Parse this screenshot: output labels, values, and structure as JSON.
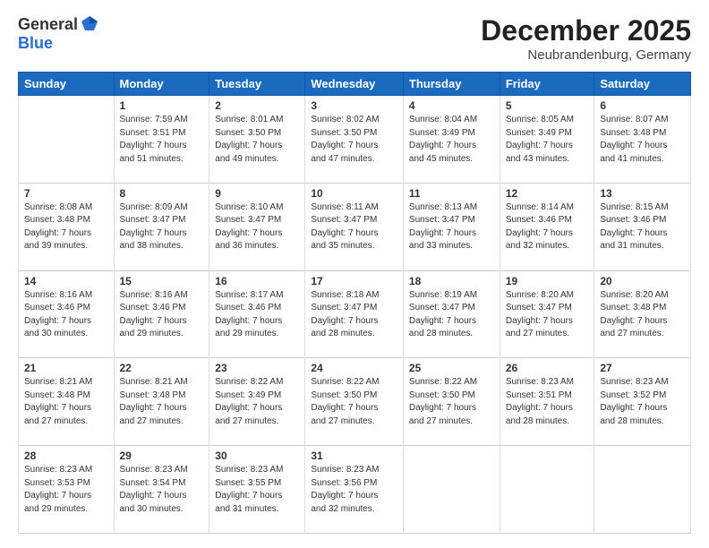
{
  "logo": {
    "general": "General",
    "blue": "Blue"
  },
  "title": "December 2025",
  "subtitle": "Neubrandenburg, Germany",
  "days_of_week": [
    "Sunday",
    "Monday",
    "Tuesday",
    "Wednesday",
    "Thursday",
    "Friday",
    "Saturday"
  ],
  "weeks": [
    [
      {
        "day": "",
        "info": ""
      },
      {
        "day": "1",
        "info": "Sunrise: 7:59 AM\nSunset: 3:51 PM\nDaylight: 7 hours\nand 51 minutes."
      },
      {
        "day": "2",
        "info": "Sunrise: 8:01 AM\nSunset: 3:50 PM\nDaylight: 7 hours\nand 49 minutes."
      },
      {
        "day": "3",
        "info": "Sunrise: 8:02 AM\nSunset: 3:50 PM\nDaylight: 7 hours\nand 47 minutes."
      },
      {
        "day": "4",
        "info": "Sunrise: 8:04 AM\nSunset: 3:49 PM\nDaylight: 7 hours\nand 45 minutes."
      },
      {
        "day": "5",
        "info": "Sunrise: 8:05 AM\nSunset: 3:49 PM\nDaylight: 7 hours\nand 43 minutes."
      },
      {
        "day": "6",
        "info": "Sunrise: 8:07 AM\nSunset: 3:48 PM\nDaylight: 7 hours\nand 41 minutes."
      }
    ],
    [
      {
        "day": "7",
        "info": "Sunrise: 8:08 AM\nSunset: 3:48 PM\nDaylight: 7 hours\nand 39 minutes."
      },
      {
        "day": "8",
        "info": "Sunrise: 8:09 AM\nSunset: 3:47 PM\nDaylight: 7 hours\nand 38 minutes."
      },
      {
        "day": "9",
        "info": "Sunrise: 8:10 AM\nSunset: 3:47 PM\nDaylight: 7 hours\nand 36 minutes."
      },
      {
        "day": "10",
        "info": "Sunrise: 8:11 AM\nSunset: 3:47 PM\nDaylight: 7 hours\nand 35 minutes."
      },
      {
        "day": "11",
        "info": "Sunrise: 8:13 AM\nSunset: 3:47 PM\nDaylight: 7 hours\nand 33 minutes."
      },
      {
        "day": "12",
        "info": "Sunrise: 8:14 AM\nSunset: 3:46 PM\nDaylight: 7 hours\nand 32 minutes."
      },
      {
        "day": "13",
        "info": "Sunrise: 8:15 AM\nSunset: 3:46 PM\nDaylight: 7 hours\nand 31 minutes."
      }
    ],
    [
      {
        "day": "14",
        "info": "Sunrise: 8:16 AM\nSunset: 3:46 PM\nDaylight: 7 hours\nand 30 minutes."
      },
      {
        "day": "15",
        "info": "Sunrise: 8:16 AM\nSunset: 3:46 PM\nDaylight: 7 hours\nand 29 minutes."
      },
      {
        "day": "16",
        "info": "Sunrise: 8:17 AM\nSunset: 3:46 PM\nDaylight: 7 hours\nand 29 minutes."
      },
      {
        "day": "17",
        "info": "Sunrise: 8:18 AM\nSunset: 3:47 PM\nDaylight: 7 hours\nand 28 minutes."
      },
      {
        "day": "18",
        "info": "Sunrise: 8:19 AM\nSunset: 3:47 PM\nDaylight: 7 hours\nand 28 minutes."
      },
      {
        "day": "19",
        "info": "Sunrise: 8:20 AM\nSunset: 3:47 PM\nDaylight: 7 hours\nand 27 minutes."
      },
      {
        "day": "20",
        "info": "Sunrise: 8:20 AM\nSunset: 3:48 PM\nDaylight: 7 hours\nand 27 minutes."
      }
    ],
    [
      {
        "day": "21",
        "info": "Sunrise: 8:21 AM\nSunset: 3:48 PM\nDaylight: 7 hours\nand 27 minutes."
      },
      {
        "day": "22",
        "info": "Sunrise: 8:21 AM\nSunset: 3:48 PM\nDaylight: 7 hours\nand 27 minutes."
      },
      {
        "day": "23",
        "info": "Sunrise: 8:22 AM\nSunset: 3:49 PM\nDaylight: 7 hours\nand 27 minutes."
      },
      {
        "day": "24",
        "info": "Sunrise: 8:22 AM\nSunset: 3:50 PM\nDaylight: 7 hours\nand 27 minutes."
      },
      {
        "day": "25",
        "info": "Sunrise: 8:22 AM\nSunset: 3:50 PM\nDaylight: 7 hours\nand 27 minutes."
      },
      {
        "day": "26",
        "info": "Sunrise: 8:23 AM\nSunset: 3:51 PM\nDaylight: 7 hours\nand 28 minutes."
      },
      {
        "day": "27",
        "info": "Sunrise: 8:23 AM\nSunset: 3:52 PM\nDaylight: 7 hours\nand 28 minutes."
      }
    ],
    [
      {
        "day": "28",
        "info": "Sunrise: 8:23 AM\nSunset: 3:53 PM\nDaylight: 7 hours\nand 29 minutes."
      },
      {
        "day": "29",
        "info": "Sunrise: 8:23 AM\nSunset: 3:54 PM\nDaylight: 7 hours\nand 30 minutes."
      },
      {
        "day": "30",
        "info": "Sunrise: 8:23 AM\nSunset: 3:55 PM\nDaylight: 7 hours\nand 31 minutes."
      },
      {
        "day": "31",
        "info": "Sunrise: 8:23 AM\nSunset: 3:56 PM\nDaylight: 7 hours\nand 32 minutes."
      },
      {
        "day": "",
        "info": ""
      },
      {
        "day": "",
        "info": ""
      },
      {
        "day": "",
        "info": ""
      }
    ]
  ]
}
